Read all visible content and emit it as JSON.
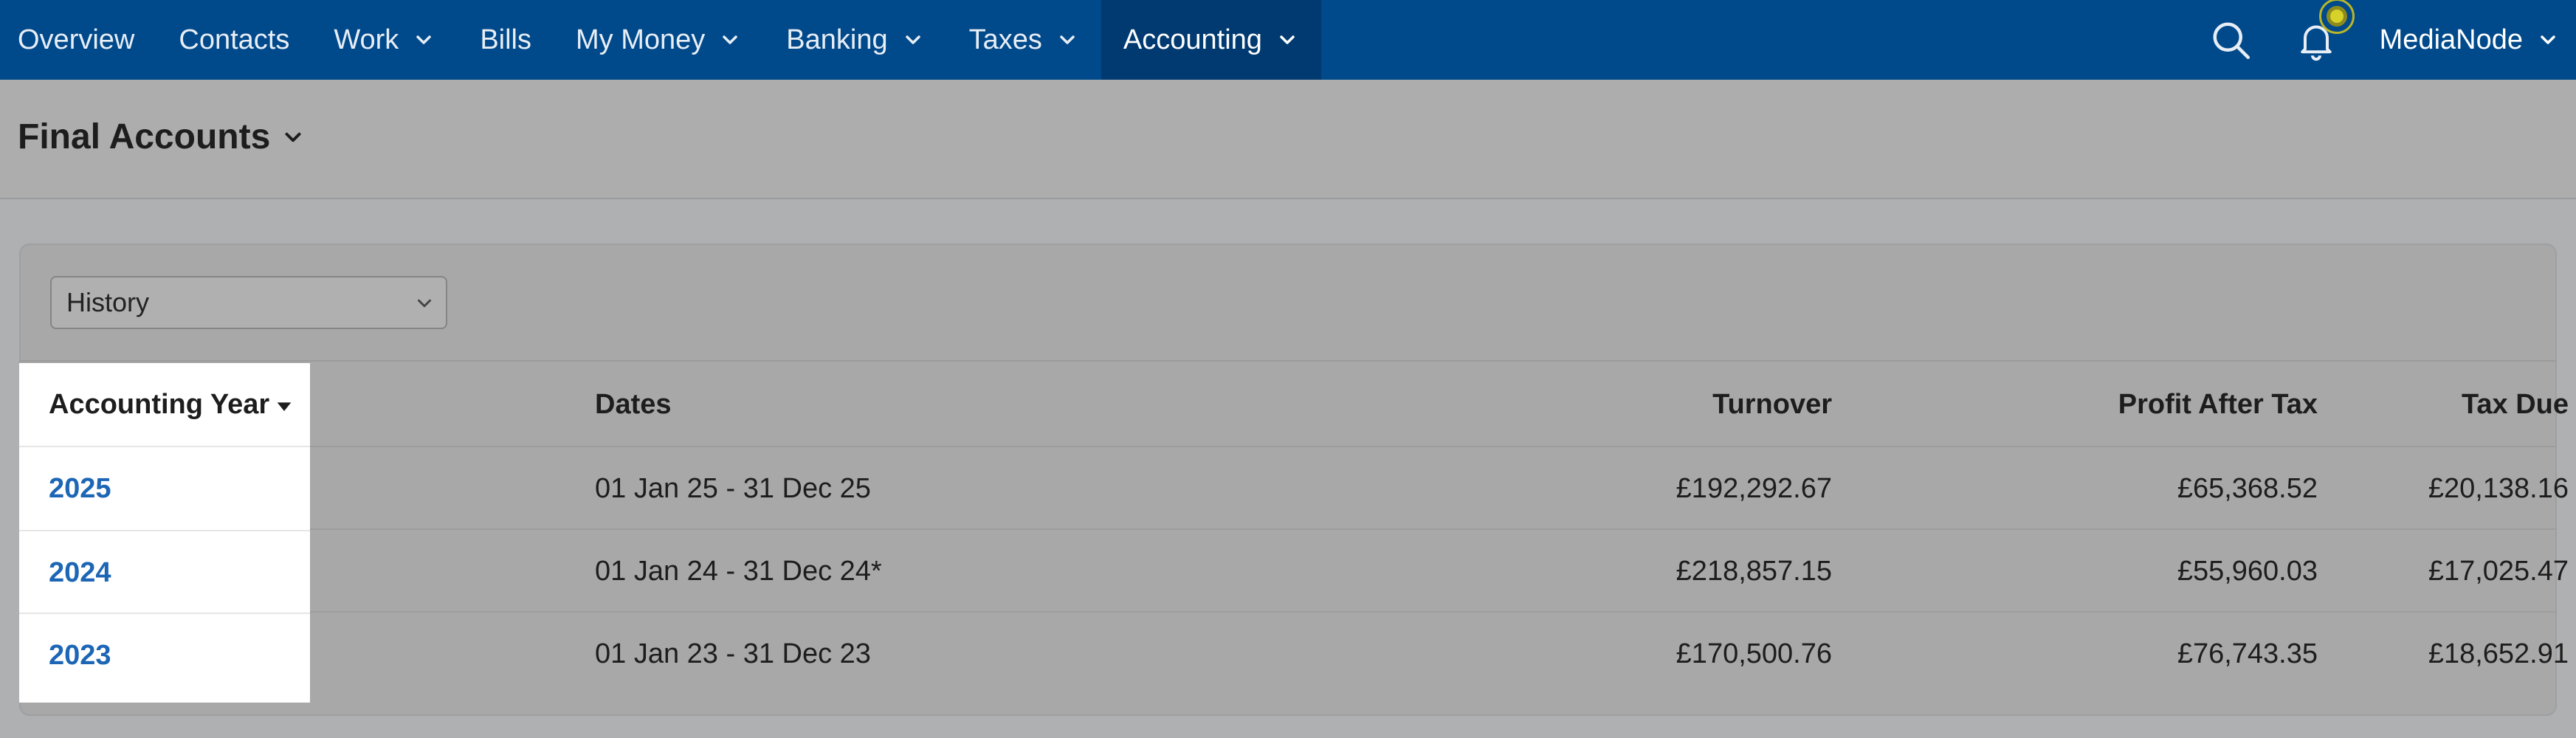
{
  "nav": {
    "items": [
      {
        "label": "Overview",
        "dropdown": false,
        "active": false
      },
      {
        "label": "Contacts",
        "dropdown": false,
        "active": false
      },
      {
        "label": "Work",
        "dropdown": true,
        "active": false
      },
      {
        "label": "Bills",
        "dropdown": false,
        "active": false
      },
      {
        "label": "My Money",
        "dropdown": true,
        "active": false
      },
      {
        "label": "Banking",
        "dropdown": true,
        "active": false
      },
      {
        "label": "Taxes",
        "dropdown": true,
        "active": false
      },
      {
        "label": "Accounting",
        "dropdown": true,
        "active": true
      }
    ],
    "user": "MediaNode",
    "icons": {
      "search": "search-icon",
      "notifications": "bell-icon"
    }
  },
  "page": {
    "title": "Final Accounts"
  },
  "filter": {
    "selected": "History"
  },
  "table": {
    "columns": {
      "year": "Accounting Year",
      "dates": "Dates",
      "turnover": "Turnover",
      "profit": "Profit After Tax",
      "tax": "Tax Due"
    },
    "rows": [
      {
        "year": "2025",
        "dates": "01 Jan 25 - 31 Dec 25",
        "turnover": "£192,292.67",
        "profit": "£65,368.52",
        "tax": "£20,138.16"
      },
      {
        "year": "2024",
        "dates": "01 Jan 24 - 31 Dec 24*",
        "turnover": "£218,857.15",
        "profit": "£55,960.03",
        "tax": "£17,025.47"
      },
      {
        "year": "2023",
        "dates": "01 Jan 23 - 31 Dec 23",
        "turnover": "£170,500.76",
        "profit": "£76,743.35",
        "tax": "£18,652.91"
      }
    ]
  },
  "colors": {
    "nav_bg": "#00498a",
    "nav_active_bg": "#003a70",
    "link": "#1c66b5",
    "notification": "#d6d22a"
  }
}
